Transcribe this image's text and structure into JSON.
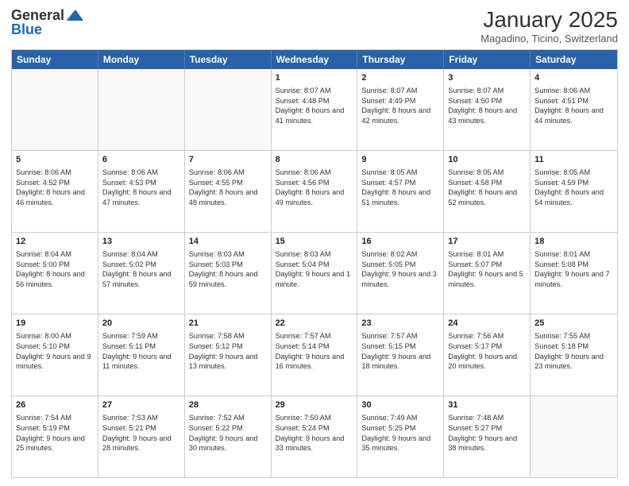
{
  "header": {
    "logo_general": "General",
    "logo_blue": "Blue",
    "title": "January 2025",
    "subtitle": "Magadino, Ticino, Switzerland"
  },
  "days_of_week": [
    "Sunday",
    "Monday",
    "Tuesday",
    "Wednesday",
    "Thursday",
    "Friday",
    "Saturday"
  ],
  "weeks": [
    [
      {
        "day": "",
        "empty": true
      },
      {
        "day": "",
        "empty": true
      },
      {
        "day": "",
        "empty": true
      },
      {
        "day": "1",
        "sunrise": "Sunrise: 8:07 AM",
        "sunset": "Sunset: 4:48 PM",
        "daylight": "Daylight: 8 hours and 41 minutes."
      },
      {
        "day": "2",
        "sunrise": "Sunrise: 8:07 AM",
        "sunset": "Sunset: 4:49 PM",
        "daylight": "Daylight: 8 hours and 42 minutes."
      },
      {
        "day": "3",
        "sunrise": "Sunrise: 8:07 AM",
        "sunset": "Sunset: 4:50 PM",
        "daylight": "Daylight: 8 hours and 43 minutes."
      },
      {
        "day": "4",
        "sunrise": "Sunrise: 8:06 AM",
        "sunset": "Sunset: 4:51 PM",
        "daylight": "Daylight: 8 hours and 44 minutes."
      }
    ],
    [
      {
        "day": "5",
        "sunrise": "Sunrise: 8:06 AM",
        "sunset": "Sunset: 4:52 PM",
        "daylight": "Daylight: 8 hours and 46 minutes."
      },
      {
        "day": "6",
        "sunrise": "Sunrise: 8:06 AM",
        "sunset": "Sunset: 4:53 PM",
        "daylight": "Daylight: 8 hours and 47 minutes."
      },
      {
        "day": "7",
        "sunrise": "Sunrise: 8:06 AM",
        "sunset": "Sunset: 4:55 PM",
        "daylight": "Daylight: 8 hours and 48 minutes."
      },
      {
        "day": "8",
        "sunrise": "Sunrise: 8:06 AM",
        "sunset": "Sunset: 4:56 PM",
        "daylight": "Daylight: 8 hours and 49 minutes."
      },
      {
        "day": "9",
        "sunrise": "Sunrise: 8:05 AM",
        "sunset": "Sunset: 4:57 PM",
        "daylight": "Daylight: 8 hours and 51 minutes."
      },
      {
        "day": "10",
        "sunrise": "Sunrise: 8:05 AM",
        "sunset": "Sunset: 4:58 PM",
        "daylight": "Daylight: 8 hours and 52 minutes."
      },
      {
        "day": "11",
        "sunrise": "Sunrise: 8:05 AM",
        "sunset": "Sunset: 4:59 PM",
        "daylight": "Daylight: 8 hours and 54 minutes."
      }
    ],
    [
      {
        "day": "12",
        "sunrise": "Sunrise: 8:04 AM",
        "sunset": "Sunset: 5:00 PM",
        "daylight": "Daylight: 8 hours and 56 minutes."
      },
      {
        "day": "13",
        "sunrise": "Sunrise: 8:04 AM",
        "sunset": "Sunset: 5:02 PM",
        "daylight": "Daylight: 8 hours and 57 minutes."
      },
      {
        "day": "14",
        "sunrise": "Sunrise: 8:03 AM",
        "sunset": "Sunset: 5:03 PM",
        "daylight": "Daylight: 8 hours and 59 minutes."
      },
      {
        "day": "15",
        "sunrise": "Sunrise: 8:03 AM",
        "sunset": "Sunset: 5:04 PM",
        "daylight": "Daylight: 9 hours and 1 minute."
      },
      {
        "day": "16",
        "sunrise": "Sunrise: 8:02 AM",
        "sunset": "Sunset: 5:05 PM",
        "daylight": "Daylight: 9 hours and 3 minutes."
      },
      {
        "day": "17",
        "sunrise": "Sunrise: 8:01 AM",
        "sunset": "Sunset: 5:07 PM",
        "daylight": "Daylight: 9 hours and 5 minutes."
      },
      {
        "day": "18",
        "sunrise": "Sunrise: 8:01 AM",
        "sunset": "Sunset: 5:08 PM",
        "daylight": "Daylight: 9 hours and 7 minutes."
      }
    ],
    [
      {
        "day": "19",
        "sunrise": "Sunrise: 8:00 AM",
        "sunset": "Sunset: 5:10 PM",
        "daylight": "Daylight: 9 hours and 9 minutes."
      },
      {
        "day": "20",
        "sunrise": "Sunrise: 7:59 AM",
        "sunset": "Sunset: 5:11 PM",
        "daylight": "Daylight: 9 hours and 11 minutes."
      },
      {
        "day": "21",
        "sunrise": "Sunrise: 7:58 AM",
        "sunset": "Sunset: 5:12 PM",
        "daylight": "Daylight: 9 hours and 13 minutes."
      },
      {
        "day": "22",
        "sunrise": "Sunrise: 7:57 AM",
        "sunset": "Sunset: 5:14 PM",
        "daylight": "Daylight: 9 hours and 16 minutes."
      },
      {
        "day": "23",
        "sunrise": "Sunrise: 7:57 AM",
        "sunset": "Sunset: 5:15 PM",
        "daylight": "Daylight: 9 hours and 18 minutes."
      },
      {
        "day": "24",
        "sunrise": "Sunrise: 7:56 AM",
        "sunset": "Sunset: 5:17 PM",
        "daylight": "Daylight: 9 hours and 20 minutes."
      },
      {
        "day": "25",
        "sunrise": "Sunrise: 7:55 AM",
        "sunset": "Sunset: 5:18 PM",
        "daylight": "Daylight: 9 hours and 23 minutes."
      }
    ],
    [
      {
        "day": "26",
        "sunrise": "Sunrise: 7:54 AM",
        "sunset": "Sunset: 5:19 PM",
        "daylight": "Daylight: 9 hours and 25 minutes."
      },
      {
        "day": "27",
        "sunrise": "Sunrise: 7:53 AM",
        "sunset": "Sunset: 5:21 PM",
        "daylight": "Daylight: 9 hours and 28 minutes."
      },
      {
        "day": "28",
        "sunrise": "Sunrise: 7:52 AM",
        "sunset": "Sunset: 5:22 PM",
        "daylight": "Daylight: 9 hours and 30 minutes."
      },
      {
        "day": "29",
        "sunrise": "Sunrise: 7:50 AM",
        "sunset": "Sunset: 5:24 PM",
        "daylight": "Daylight: 9 hours and 33 minutes."
      },
      {
        "day": "30",
        "sunrise": "Sunrise: 7:49 AM",
        "sunset": "Sunset: 5:25 PM",
        "daylight": "Daylight: 9 hours and 35 minutes."
      },
      {
        "day": "31",
        "sunrise": "Sunrise: 7:48 AM",
        "sunset": "Sunset: 5:27 PM",
        "daylight": "Daylight: 9 hours and 38 minutes."
      },
      {
        "day": "",
        "empty": true
      }
    ]
  ]
}
